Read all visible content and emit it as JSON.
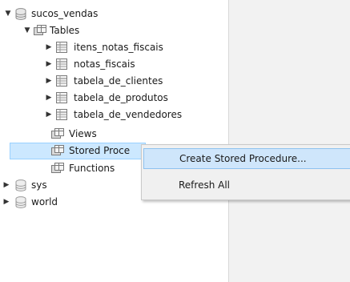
{
  "tree": {
    "schema_name": "sucos_vendas",
    "tables_label": "Tables",
    "tables": [
      "itens_notas_fiscais",
      "notas_fiscais",
      "tabela_de_clientes",
      "tabela_de_produtos",
      "tabela_de_vendedores"
    ],
    "views_label": "Views",
    "stored_procedures_label": "Stored Proce",
    "functions_label": "Functions",
    "other_schemas": [
      "sys",
      "world"
    ]
  },
  "context_menu": {
    "create_label": "Create Stored Procedure...",
    "refresh_label": "Refresh All"
  },
  "colors": {
    "selection_bg": "#cce8ff",
    "menu_hover_bg": "#cfe6fb",
    "menu_bg": "#f0f0f0"
  }
}
